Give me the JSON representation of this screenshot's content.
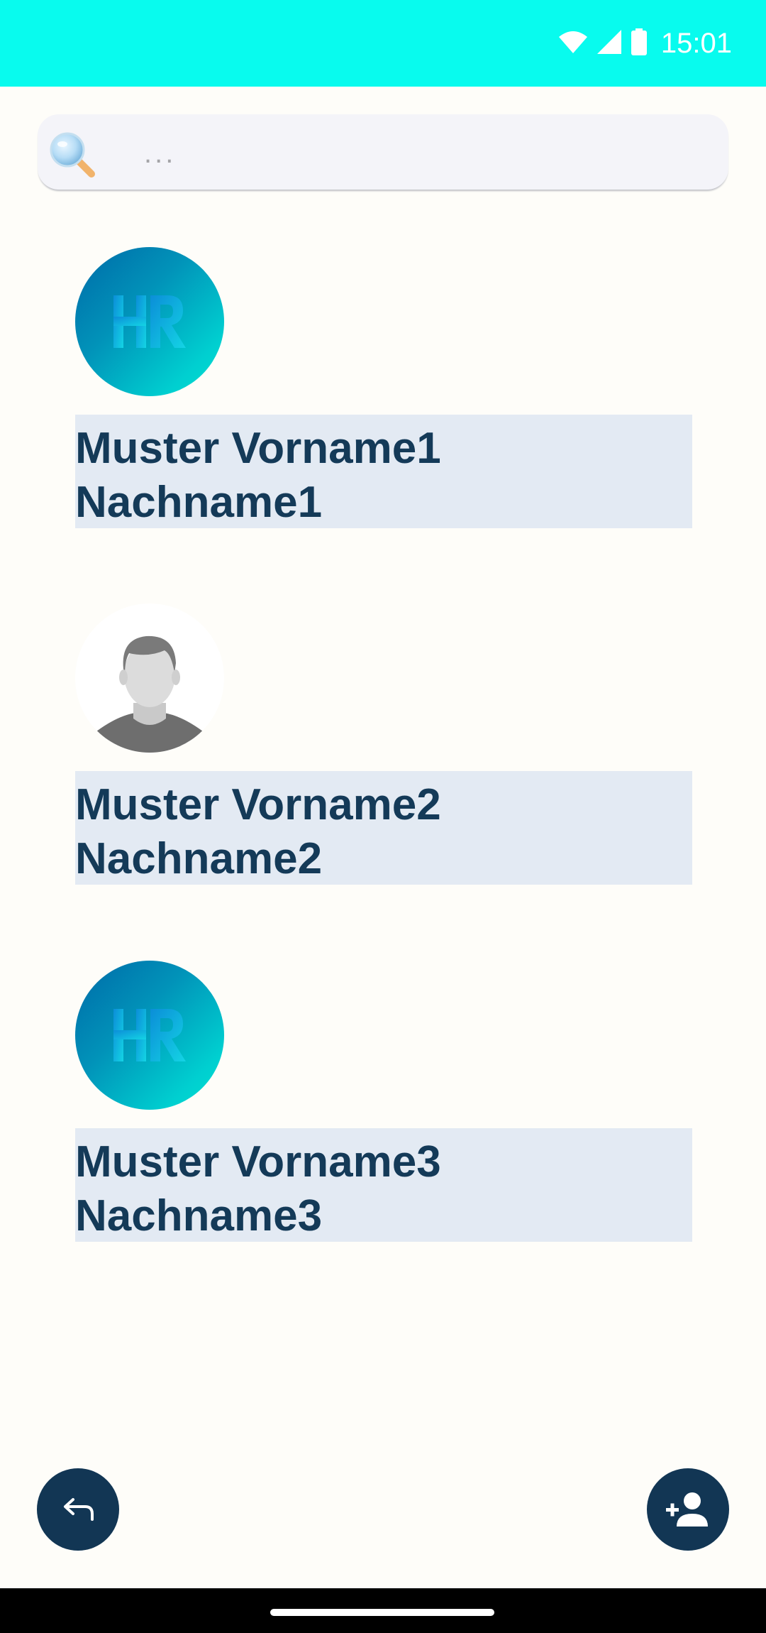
{
  "status_bar": {
    "time": "15:01",
    "icons": [
      "wifi-icon",
      "cellular-signal-icon",
      "battery-icon"
    ],
    "color": "#08fbee"
  },
  "search": {
    "placeholder": "...",
    "value": "",
    "icon": "magnifier-icon"
  },
  "contacts": [
    {
      "first_line": "Muster Vorname1",
      "second_line": "Nachname1",
      "avatar": "hr-logo"
    },
    {
      "first_line": "Muster Vorname2",
      "second_line": "Nachname2",
      "avatar": "person-placeholder"
    },
    {
      "first_line": "Muster Vorname3",
      "second_line": "Nachname3",
      "avatar": "hr-logo"
    }
  ],
  "actions": {
    "back_icon": "undo-arrow-icon",
    "add_icon": "add-person-icon",
    "fab_color": "#123654"
  },
  "colors": {
    "name_text": "#143a58",
    "name_background": "#e3eaf3",
    "page_background": "#fefdf9"
  }
}
